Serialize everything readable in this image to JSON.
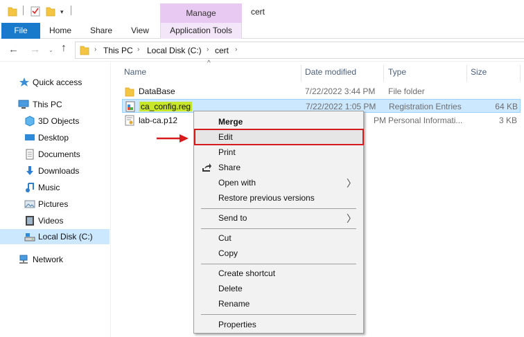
{
  "qat": {
    "icons": [
      "folder-icon",
      "properties-check-icon",
      "new-folder-icon",
      "customize-dropdown-icon"
    ],
    "dropdown_glyph": "▾"
  },
  "window": {
    "title": "cert"
  },
  "ribbon": {
    "contextual_group": "Manage",
    "tabs": [
      {
        "label": "File",
        "active": true
      },
      {
        "label": "Home"
      },
      {
        "label": "Share"
      },
      {
        "label": "View"
      },
      {
        "label": "Application Tools",
        "contextual": true
      }
    ]
  },
  "address": {
    "back": "←",
    "forward": "→",
    "recent": "⌄",
    "up": "↑",
    "crumbs": [
      "This PC",
      "Local Disk (C:)",
      "cert"
    ],
    "separator": "›"
  },
  "navpane": {
    "items": [
      {
        "label": "Quick access",
        "icon": "star-icon"
      },
      {
        "label": "This PC",
        "icon": "computer-icon"
      },
      {
        "label": "3D Objects",
        "icon": "cube-icon"
      },
      {
        "label": "Desktop",
        "icon": "desktop-icon"
      },
      {
        "label": "Documents",
        "icon": "documents-icon"
      },
      {
        "label": "Downloads",
        "icon": "download-icon"
      },
      {
        "label": "Music",
        "icon": "music-icon"
      },
      {
        "label": "Pictures",
        "icon": "pictures-icon"
      },
      {
        "label": "Videos",
        "icon": "videos-icon"
      },
      {
        "label": "Local Disk (C:)",
        "icon": "drive-icon",
        "selected": true
      },
      {
        "label": "Network",
        "icon": "network-icon"
      }
    ]
  },
  "files": {
    "sort_indicator": "^",
    "columns": {
      "name": "Name",
      "date": "Date modified",
      "type": "Type",
      "size": "Size"
    },
    "rows": [
      {
        "name": "DataBase",
        "date": "7/22/2022 3:44 PM",
        "type": "File folder",
        "size": "",
        "icon": "folder-icon"
      },
      {
        "name": "ca_config.reg",
        "date": "7/22/2022 1:05 PM",
        "type": "Registration Entries",
        "size": "64 KB",
        "icon": "registry-file-icon",
        "selected": true
      },
      {
        "name": "lab-ca.p12",
        "date": "PM",
        "type": "Personal Informati...",
        "size": "3 KB",
        "icon": "certificate-icon"
      }
    ]
  },
  "context_menu": {
    "items": [
      {
        "label": "Merge",
        "default": true
      },
      {
        "label": "Edit",
        "highlighted": true
      },
      {
        "label": "Print"
      },
      {
        "label": "Share",
        "icon": "share-icon"
      },
      {
        "label": "Open with",
        "submenu": true
      },
      {
        "label": "Restore previous versions"
      },
      {
        "label": "Send to",
        "submenu": true
      },
      {
        "label": "Cut"
      },
      {
        "label": "Copy"
      },
      {
        "label": "Create shortcut"
      },
      {
        "label": "Delete"
      },
      {
        "label": "Rename"
      },
      {
        "label": "Properties"
      }
    ],
    "submenu_glyph": "〉"
  },
  "annotation": {
    "arrow_color": "#d51b1b",
    "highlight_color": "#d51b1b"
  },
  "colors": {
    "file_tab": "#1979ca",
    "manage_tab": "#e8c9f1",
    "selection": "#cce8ff",
    "filename_highlight": "#c8e62a"
  }
}
